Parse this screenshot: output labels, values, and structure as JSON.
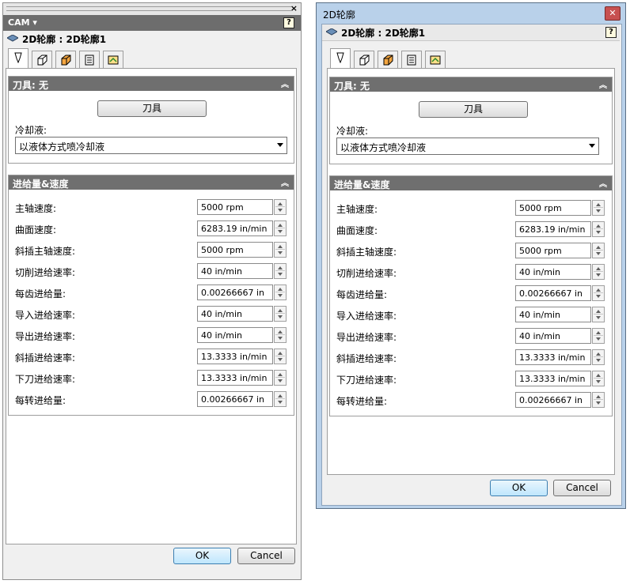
{
  "left_panel": {
    "cam_label": "CAM ▾",
    "help": "?",
    "operation_title": "2D轮廓 : 2D轮廓1",
    "tool_group_title": "刀具: 无",
    "tool_button": "刀具",
    "coolant_label": "冷却液:",
    "coolant_value": "以液体方式喷冷却液",
    "feed_group_title": "进给量&速度",
    "fields": [
      {
        "label": "主轴速度:",
        "value": "5000 rpm"
      },
      {
        "label": "曲面速度:",
        "value": "6283.19 in/min"
      },
      {
        "label": "斜插主轴速度:",
        "value": "5000 rpm"
      },
      {
        "label": "切削进给速率:",
        "value": "40 in/min"
      },
      {
        "label": "每齿进给量:",
        "value": "0.00266667 in"
      },
      {
        "label": "导入进给速率:",
        "value": "40 in/min"
      },
      {
        "label": "导出进给速率:",
        "value": "40 in/min"
      },
      {
        "label": "斜插进给速率:",
        "value": "13.3333 in/min"
      },
      {
        "label": "下刀进给速率:",
        "value": "13.3333 in/min"
      },
      {
        "label": "每转进给量:",
        "value": "0.00266667 in"
      }
    ],
    "ok": "OK",
    "cancel": "Cancel",
    "close": "×"
  },
  "right_dialog": {
    "window_title": "2D轮廓",
    "close": "✕",
    "help": "?",
    "operation_title": "2D轮廓 : 2D轮廓1",
    "tool_group_title": "刀具: 无",
    "tool_button": "刀具",
    "coolant_label": "冷却液:",
    "coolant_value": "以液体方式喷冷却液",
    "feed_group_title": "进给量&速度",
    "fields": [
      {
        "label": "主轴速度:",
        "value": "5000 rpm"
      },
      {
        "label": "曲面速度:",
        "value": "6283.19 in/min"
      },
      {
        "label": "斜插主轴速度:",
        "value": "5000 rpm"
      },
      {
        "label": "切削进给速率:",
        "value": "40 in/min"
      },
      {
        "label": "每齿进给量:",
        "value": "0.00266667 in"
      },
      {
        "label": "导入进给速率:",
        "value": "40 in/min"
      },
      {
        "label": "导出进给速率:",
        "value": "40 in/min"
      },
      {
        "label": "斜插进给速率:",
        "value": "13.3333 in/min"
      },
      {
        "label": "下刀进给速率:",
        "value": "13.3333 in/min"
      },
      {
        "label": "每转进给量:",
        "value": "0.00266667 in"
      }
    ],
    "ok": "OK",
    "cancel": "Cancel"
  },
  "tabs": [
    "tool-tab-icon",
    "geometry-tab-icon",
    "heights-tab-icon",
    "passes-tab-icon",
    "linking-tab-icon"
  ],
  "colors": {
    "group_header": "#6f6f6f",
    "dialog_frame": "#b9d1ea",
    "default_button": "#3c7fb1"
  }
}
